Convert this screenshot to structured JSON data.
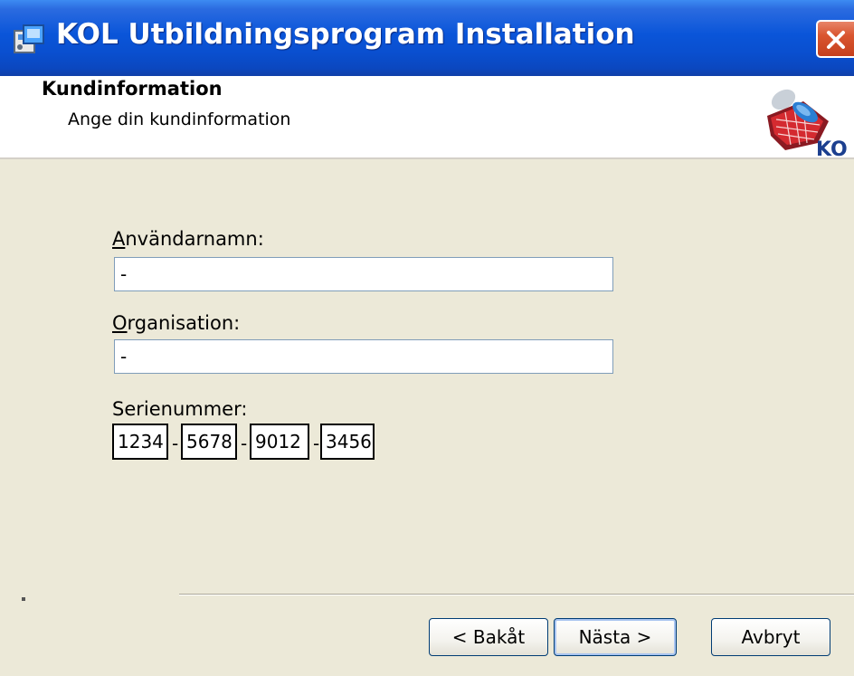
{
  "window": {
    "title": "KOL Utbildningsprogram Installation"
  },
  "header": {
    "title": "Kundinformation",
    "subtitle": "Ange din kundinformation",
    "logo_text": "KOL"
  },
  "form": {
    "username": {
      "label_access_key": "A",
      "label_rest": "nvändarnamn:",
      "value": "-"
    },
    "organisation": {
      "label_access_key": "O",
      "label_rest": "rganisation:",
      "value": "-"
    },
    "serial": {
      "label": "Serienummer:",
      "parts": [
        "1234",
        "5678",
        "9012",
        "3456"
      ],
      "separator": "-"
    }
  },
  "buttons": {
    "back": "< Bakåt",
    "next": "Nästa >",
    "cancel": "Avbryt"
  },
  "colors": {
    "titlebar": "#0a55d9",
    "face": "#ece9d8",
    "close": "#d9552f",
    "input_border": "#7f9db9"
  }
}
